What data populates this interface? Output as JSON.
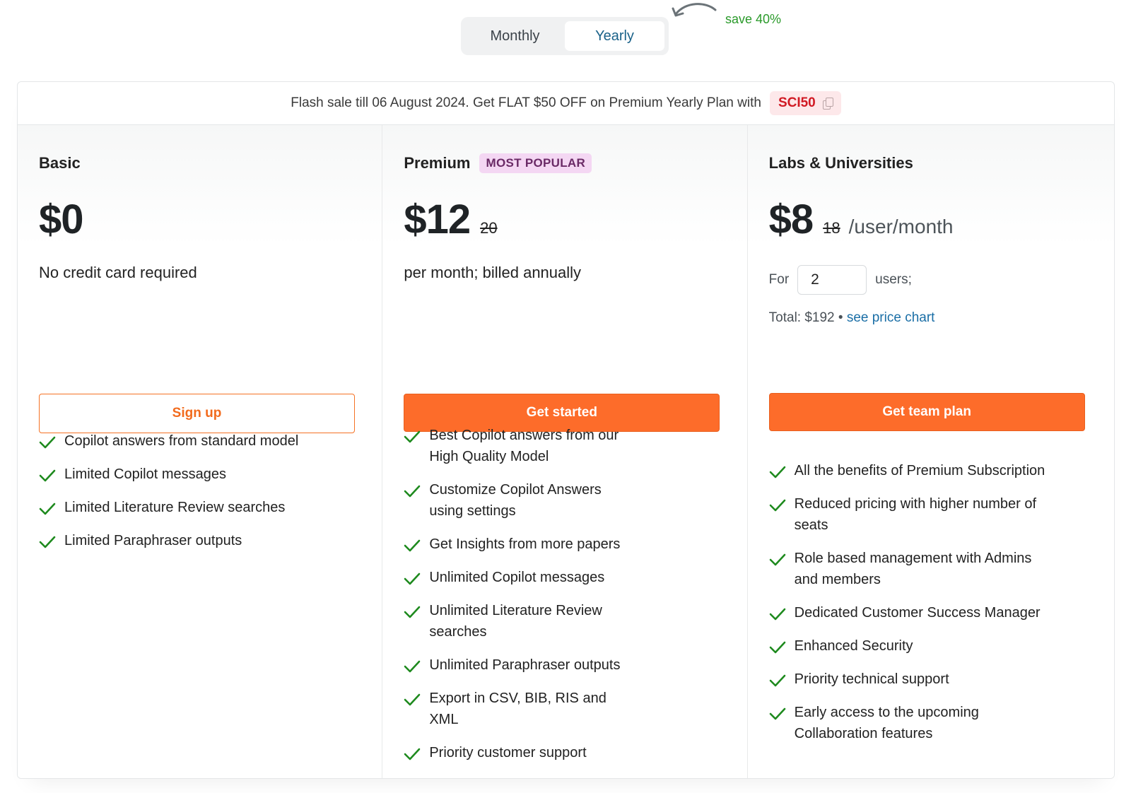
{
  "billing_toggle": {
    "options": [
      "Monthly",
      "Yearly"
    ],
    "selected": "Yearly",
    "save_note": "save 40%"
  },
  "flash_sale": {
    "text": "Flash sale till 06 August 2024. Get FLAT $50 OFF on Premium Yearly Plan with",
    "coupon_code": "SCI50"
  },
  "plans": [
    {
      "name": "Basic",
      "price": "$0",
      "subtitle": "No credit card required",
      "cta": "Sign up",
      "features": [
        "Copilot answers from standard model",
        "Limited Copilot messages",
        "Limited Literature Review searches",
        "Limited Paraphraser outputs"
      ]
    },
    {
      "name": "Premium",
      "badge": "MOST POPULAR",
      "price": "$12",
      "old_price": "20",
      "subtitle": "per month; billed annually",
      "cta": "Get started",
      "features": [
        "Best Copilot answers from our High Quality Model",
        "Customize Copilot Answers using settings",
        "Get Insights from more papers",
        "Unlimited Copilot messages",
        "Unlimited Literature Review searches",
        "Unlimited Paraphraser outputs",
        "Export in CSV, BIB, RIS and XML",
        "Priority customer support"
      ]
    },
    {
      "name": "Labs & Universities",
      "price": "$8",
      "old_price": "18",
      "per_unit": "/user/month",
      "users_prefix": "For",
      "users_value": "2",
      "users_suffix": "users;",
      "total": "Total: $192 •",
      "price_chart_link": "see price chart",
      "cta": "Get team plan",
      "features": [
        "All the benefits of Premium Subscription",
        "Reduced pricing with higher number of seats",
        "Role based management with Admins and members",
        "Dedicated Customer Success Manager",
        "Enhanced Security",
        "Priority technical support",
        "Early access to the upcoming Collaboration features"
      ]
    }
  ],
  "colors": {
    "accent_orange": "#fd6c2a",
    "check_green": "#1e8a1e",
    "link_blue": "#1a6ea6",
    "coupon_red": "#d11a24"
  }
}
